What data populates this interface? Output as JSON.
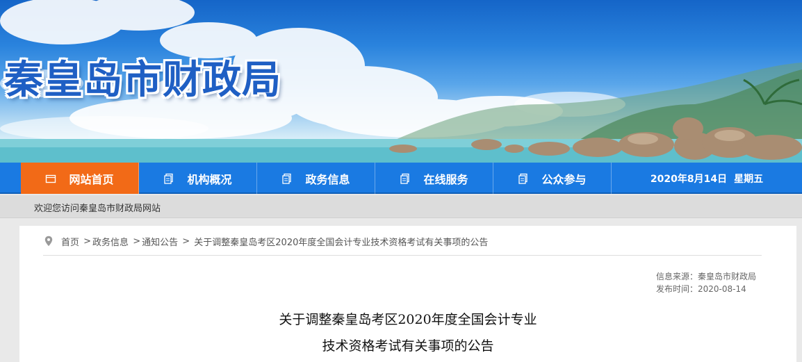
{
  "header": {
    "site_title": "秦皇岛市财政局"
  },
  "nav": {
    "items": [
      {
        "label": "网站首页",
        "icon": "home-icon",
        "active": true
      },
      {
        "label": "机构概况",
        "icon": "document-icon",
        "active": false
      },
      {
        "label": "政务信息",
        "icon": "document-icon",
        "active": false
      },
      {
        "label": "在线服务",
        "icon": "document-icon",
        "active": false
      },
      {
        "label": "公众参与",
        "icon": "document-icon",
        "active": false
      }
    ],
    "date": "2020年8月14日",
    "weekday": "星期五"
  },
  "welcome": {
    "text": "欢迎您访问秦皇岛市财政局网站"
  },
  "breadcrumb": {
    "icon": "location-pin-icon",
    "items": [
      "首页",
      "政务信息",
      "通知公告",
      "关于调整秦皇岛考区2020年度全国会计专业技术资格考试有关事项的公告"
    ]
  },
  "article": {
    "source": "信息来源：秦皇岛市财政局",
    "publish_time": "发布时间：2020-08-14",
    "title_line1": "关于调整秦皇岛考区2020年度全国会计专业",
    "title_line2": "技术资格考试有关事项的公告"
  },
  "colors": {
    "nav_bg": "#1a7ae2",
    "nav_active": "#f26a17",
    "title_blue": "#1f5fc4"
  }
}
